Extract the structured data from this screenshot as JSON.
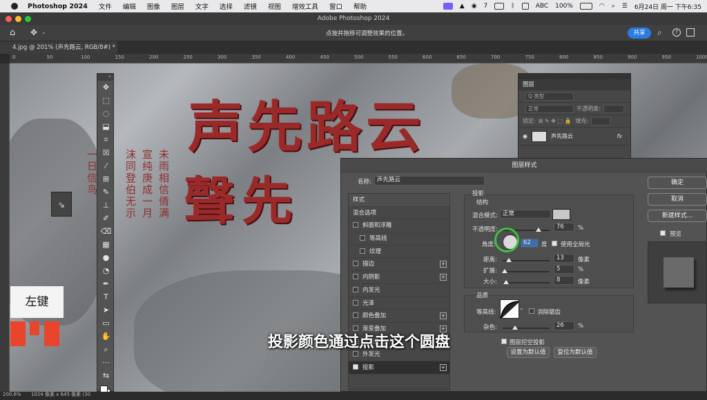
{
  "menubar": {
    "app_name": "Photoshop 2024",
    "menus": [
      "文件",
      "编辑",
      "图像",
      "图层",
      "文字",
      "选择",
      "滤镜",
      "视图",
      "增效工具",
      "窗口",
      "帮助"
    ],
    "wechat_count": "7",
    "input_method": "ABC",
    "battery": "100%",
    "datetime": "6月24日 周一 下午6:35"
  },
  "window": {
    "title": "Adobe Photoshop 2024"
  },
  "options_bar": {
    "hint": "点按并拖移可调整效果的位置。",
    "share_label": "共享"
  },
  "document": {
    "tab_title": "4.jpg @ 201% (声先路云, RGB/8#) *"
  },
  "ruler_ticks": [
    "0",
    "50",
    "100",
    "150",
    "200",
    "250",
    "300",
    "350",
    "400",
    "450",
    "500",
    "550",
    "600",
    "650",
    "700",
    "750",
    "800",
    "850",
    "900",
    "950",
    "1000"
  ],
  "canvas_text": {
    "line1": "声先路云",
    "line2": "聲先",
    "small_cols": [
      "沫同登伯无示",
      "宣纯庚成一月",
      "未雨相信倩满",
      "一日信鸟"
    ]
  },
  "layers_panel": {
    "title": "图层",
    "filter_placeholder": "Q 类型",
    "blend_mode": "正常",
    "opacity_label": "不透明度:",
    "lock_label": "锁定:",
    "fill_label": "填充:",
    "layer_name": "声先路云",
    "fx_label": "fx"
  },
  "dialog": {
    "title": "图层样式",
    "name_label": "名称:",
    "name_value": "声先路云",
    "styles_header": "样式",
    "styles": [
      {
        "label": "混合选项",
        "checkbox": false,
        "plus": false,
        "indent": false,
        "checked": false
      },
      {
        "label": "斜面和浮雕",
        "checkbox": true,
        "plus": false,
        "indent": false,
        "checked": false
      },
      {
        "label": "等高线",
        "checkbox": true,
        "plus": false,
        "indent": true,
        "checked": false
      },
      {
        "label": "纹理",
        "checkbox": true,
        "plus": false,
        "indent": true,
        "checked": false
      },
      {
        "label": "描边",
        "checkbox": true,
        "plus": true,
        "indent": false,
        "checked": false
      },
      {
        "label": "内阴影",
        "checkbox": true,
        "plus": true,
        "indent": false,
        "checked": false
      },
      {
        "label": "内发光",
        "checkbox": true,
        "plus": false,
        "indent": false,
        "checked": false
      },
      {
        "label": "光泽",
        "checkbox": true,
        "plus": false,
        "indent": false,
        "checked": false
      },
      {
        "label": "颜色叠加",
        "checkbox": true,
        "plus": true,
        "indent": false,
        "checked": false
      },
      {
        "label": "渐变叠加",
        "checkbox": true,
        "plus": true,
        "indent": false,
        "checked": false
      },
      {
        "label": "图案叠加",
        "checkbox": true,
        "plus": false,
        "indent": false,
        "checked": false
      },
      {
        "label": "外发光",
        "checkbox": true,
        "plus": false,
        "indent": false,
        "checked": false
      },
      {
        "label": "投影",
        "checkbox": true,
        "plus": true,
        "indent": false,
        "checked": true
      }
    ],
    "section_title": "投影",
    "structure_label": "结构",
    "blend_label": "混合模式:",
    "blend_value": "正常",
    "opacity_label": "不透明度:",
    "opacity_value": "76",
    "percent": "%",
    "angle_label": "角度:",
    "angle_value": "62",
    "degree_label": "度",
    "global_light_label": "使用全局光",
    "distance_label": "距离:",
    "distance_value": "13",
    "spread_label": "扩展:",
    "spread_value": "5",
    "size_label": "大小:",
    "size_value": "8",
    "px_label": "像素",
    "quality_label": "品质",
    "contour_label": "等高线:",
    "antialias_label": "消除锯齿",
    "noise_label": "杂色:",
    "noise_value": "26",
    "knockout_label": "图层挖空投影",
    "set_default_label": "设置为默认值",
    "reset_default_label": "复位为默认值",
    "ok_label": "确定",
    "cancel_label": "取消",
    "new_style_label": "新建样式...",
    "preview_label": "预览",
    "levels": {
      "opacity": 0.76,
      "distance": 0.13,
      "spread": 0.05,
      "size": 0.08,
      "noise": 0.26
    }
  },
  "overlay": {
    "left_key": "左键",
    "subtitle": "投影颜色通过点击这个圆盘"
  },
  "status": {
    "zoom": "200.6%",
    "doc_size": "1024 像素 x 645 像素 (30"
  },
  "colors": {
    "accent": "#2a7de1",
    "highlight_circle": "#3fbf3f",
    "carving_red": "#9a2a2a",
    "indicator_red": "#e8452c"
  }
}
